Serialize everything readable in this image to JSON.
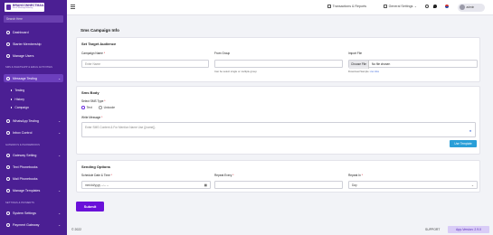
{
  "brand": {
    "name": "BRANCONNECTMAIL",
    "tagline": "Sms & Whatsapp Marketing"
  },
  "sidebar": {
    "search_placeholder": "Search Here",
    "items": [
      {
        "label": "Dashboard"
      },
      {
        "label": "Starter Membership"
      },
      {
        "label": "Manage Users"
      },
      {
        "label": "Message Testing"
      },
      {
        "label": "WhatsApp Testing"
      },
      {
        "label": "Inbox Control"
      },
      {
        "label": "Gateway Setting"
      },
      {
        "label": "Text Phonebooks"
      },
      {
        "label": "Mail Phonebooks"
      },
      {
        "label": "Manage Templates"
      },
      {
        "label": "System Settings"
      },
      {
        "label": "Payment Gateway"
      }
    ],
    "sub_items": [
      {
        "label": "Testing"
      },
      {
        "label": "History"
      },
      {
        "label": "Campaign"
      }
    ],
    "sections": [
      {
        "label": "SMS & WHATSAPP & EMAIL ACTIVITIES"
      },
      {
        "label": "GATEWAYS & PHONEBOOKS"
      },
      {
        "label": "SETTINGS & PAYMENTS"
      }
    ]
  },
  "topbar": {
    "transactions": "Transactions & Reports",
    "general_settings": "General Settings",
    "user": "admin"
  },
  "page": {
    "title": "Sms Campaign Info",
    "target_card": {
      "title": "Set Target Audience",
      "campaign_name_label": "Campaign Name",
      "campaign_name_placeholder": "Enter Name",
      "from_group_label": "From Group",
      "from_group_hint": "Can be select single or multiple group",
      "import_file_label": "Import File",
      "choose_file": "Choose File",
      "no_file": "No file chosen",
      "download_sample": "Download Sample:",
      "csv": "csv",
      "xlsx": "xlsx"
    },
    "body_card": {
      "title": "Sms Body",
      "sms_type_label": "Select SMS Type",
      "text_option": "Text",
      "unicode_option": "Unicode",
      "write_message_label": "Write Message",
      "message_placeholder": "Enter SMS Content & For Mention Name Use {{name}}",
      "use_template": "Use Template"
    },
    "sending_card": {
      "title": "Sending Options",
      "schedule_label": "Schedule Date & Time",
      "schedule_value": "mm/dd/yyyy --:-- --",
      "repeat_every_label": "Repeat Every",
      "repeat_in_label": "Repeat In",
      "repeat_in_value": "Day"
    },
    "submit": "Submit"
  },
  "footer": {
    "copyright": "© 2022",
    "support": "SUPPORT",
    "version": "App-Version: 2.9.0"
  },
  "colors": {
    "sidebar": "#4b1f93",
    "accent": "#6a11d9",
    "template_button": "#2a9fd8"
  }
}
